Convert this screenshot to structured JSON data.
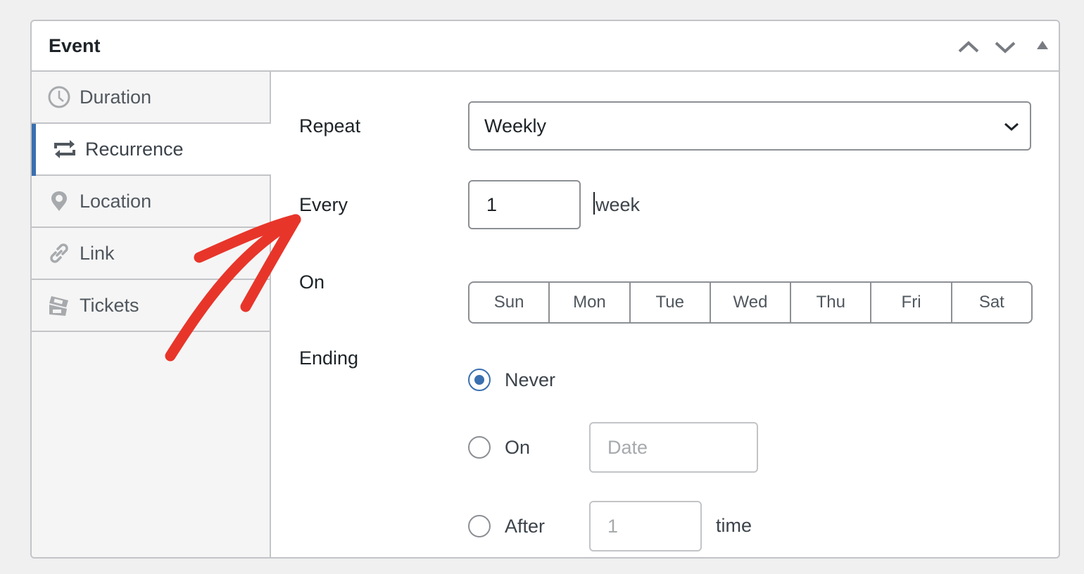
{
  "panel": {
    "title": "Event",
    "header_buttons": [
      {
        "name": "move-up",
        "icon": "chevron-up-icon"
      },
      {
        "name": "move-down",
        "icon": "chevron-down-icon"
      },
      {
        "name": "toggle-panel",
        "icon": "triangle-up-icon"
      }
    ]
  },
  "sidebar": {
    "tabs": [
      {
        "label": "Duration",
        "icon": "clock-icon",
        "active": false
      },
      {
        "label": "Recurrence",
        "icon": "repeat-icon",
        "active": true
      },
      {
        "label": "Location",
        "icon": "map-pin-icon",
        "active": false
      },
      {
        "label": "Link",
        "icon": "link-icon",
        "active": false
      },
      {
        "label": "Tickets",
        "icon": "tickets-icon",
        "active": false
      }
    ]
  },
  "form": {
    "repeat": {
      "label": "Repeat",
      "value": "Weekly"
    },
    "every": {
      "label": "Every",
      "value": "1",
      "unit": "week"
    },
    "on": {
      "label": "On",
      "days": [
        "Sun",
        "Mon",
        "Tue",
        "Wed",
        "Thu",
        "Fri",
        "Sat"
      ]
    },
    "ending": {
      "label": "Ending",
      "options": [
        {
          "label": "Never",
          "checked": true
        },
        {
          "label": "On",
          "checked": false,
          "placeholder": "Date"
        },
        {
          "label": "After",
          "checked": false,
          "placeholder": "1",
          "suffix": "time"
        }
      ]
    }
  },
  "annotation": {
    "type": "red-arrow",
    "color": "#e8352a",
    "points_to": "Every"
  },
  "colors": {
    "accent": "#3a6fb0",
    "border": "#c3c4c7",
    "sidebar_bg": "#f5f5f5",
    "page_bg": "#f0f0f1"
  }
}
